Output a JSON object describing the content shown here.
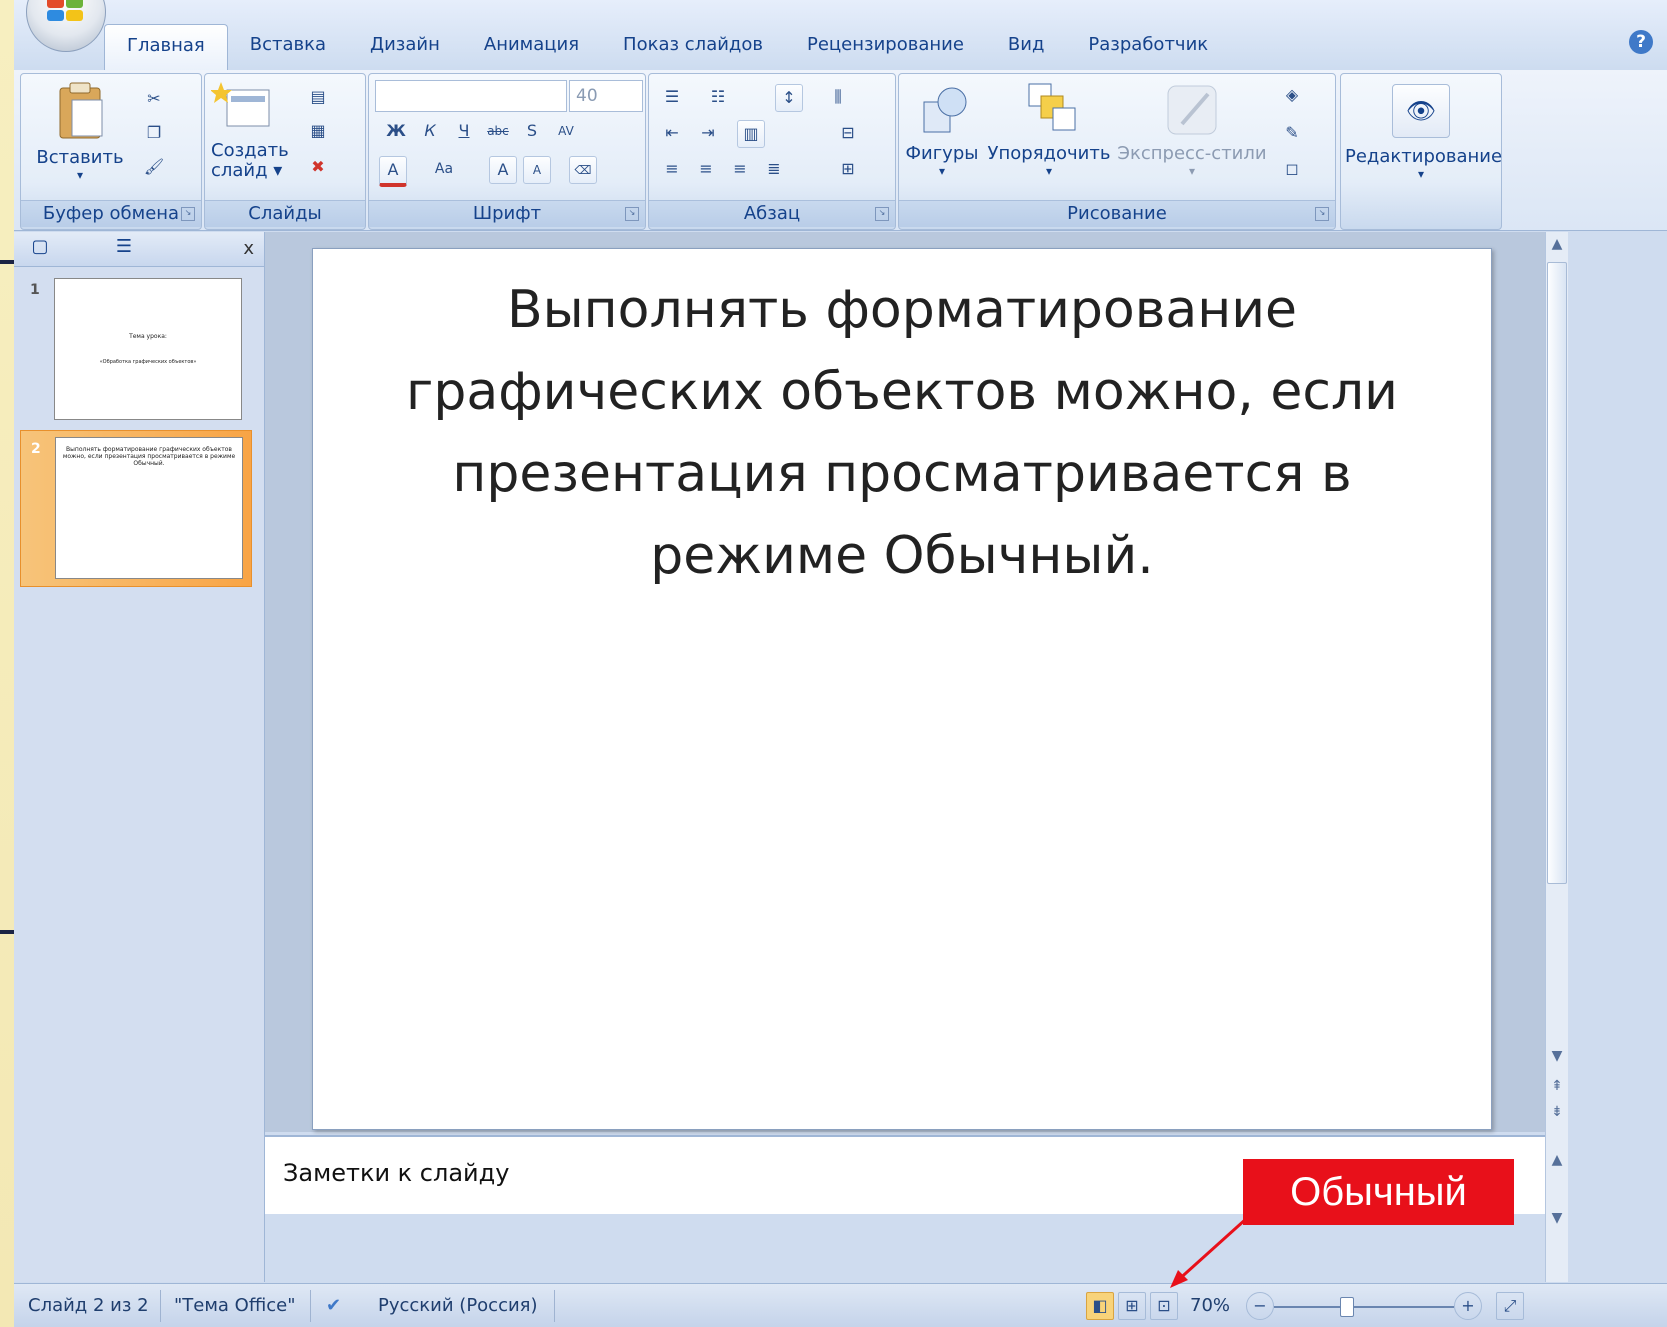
{
  "ribbon": {
    "tabs": [
      "Главная",
      "Вставка",
      "Дизайн",
      "Анимация",
      "Показ слайдов",
      "Рецензирование",
      "Вид",
      "Разработчик"
    ],
    "active_tab": 0,
    "help_label": "?",
    "groups": {
      "clipboard": {
        "label": "Буфер обмена",
        "paste": "Вставить"
      },
      "slides": {
        "label": "Слайды",
        "new_slide_line1": "Создать",
        "new_slide_line2": "слайд"
      },
      "font": {
        "label": "Шрифт",
        "font_size": "40"
      },
      "paragraph": {
        "label": "Абзац"
      },
      "drawing": {
        "label": "Рисование",
        "shapes": "Фигуры",
        "arrange": "Упорядочить",
        "quick_styles": "Экспресс-стили"
      },
      "editing": {
        "label": "Редактирование"
      }
    }
  },
  "panel": {
    "close": "x",
    "thumbnails": [
      {
        "number": "1",
        "lines": [
          "Тема урока:",
          "«Обработка графических объектов»"
        ]
      },
      {
        "number": "2",
        "lines": [
          "Выполнять форматирование графических объектов можно, если презентация просматривается в режиме Обычный."
        ]
      }
    ],
    "selected": 1
  },
  "slide": {
    "text": "Выполнять форматирование графических объектов можно, если презентация просматривается в режиме Обычный."
  },
  "notes": {
    "placeholder": "Заметки к слайду"
  },
  "status": {
    "slide_info": "Слайд 2 из 2",
    "theme": "\"Тема Office\"",
    "language": "Русский (Россия)",
    "zoom": "70%",
    "zoom_fraction": 0.4
  },
  "callout": {
    "label": "Обычный",
    "color": "#e8101a"
  },
  "colors": {
    "accent": "#15428b",
    "selection": "#f8a445"
  }
}
